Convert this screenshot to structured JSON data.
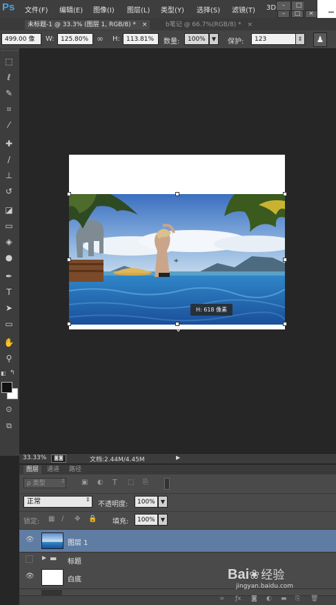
{
  "app": {
    "logo": "Ps"
  },
  "menu": {
    "items": [
      "文件(F)",
      "编辑(E)",
      "图像(I)",
      "图层(L)",
      "类型(Y)",
      "选择(S)",
      "滤镜(T)",
      "3D"
    ]
  },
  "tabs": [
    {
      "label": "未标题-1 @ 33.3% (图层 1, RGB/8) *",
      "close": "×"
    },
    {
      "label": "b笔记 @ 66.7%(RGB/8) *",
      "close": "×"
    }
  ],
  "options": {
    "x_value": "499.00 像",
    "w_label": "W:",
    "w_value": "125.80%",
    "h_label": "H:",
    "h_value": "113.81%",
    "amount_label": "数量:",
    "amount_value": "100%",
    "protect_label": "保护:",
    "protect_value": "123"
  },
  "canvas": {
    "tooltip": "H: 618 像素"
  },
  "status": {
    "zoom": "33.33%",
    "doc": "文档:2.44M/4.45M"
  },
  "layers_panel": {
    "tabs": [
      "图层",
      "通道",
      "路径"
    ],
    "filter_label": "ρ 类型",
    "blend_mode": "正常",
    "opacity_label": "不透明度:",
    "opacity_value": "100%",
    "lock_label": "锁定:",
    "fill_label": "填充:",
    "fill_value": "100%",
    "layers": [
      {
        "name": "图层 1"
      },
      {
        "name": "标题"
      },
      {
        "name": "白底"
      }
    ]
  },
  "watermark": {
    "brand_a": "Bai",
    "brand_b": "经验",
    "url": "jingyan.baidu.com"
  },
  "colors": {
    "selected_layer": "#5f7ca3",
    "logo": "#4aa3df"
  }
}
